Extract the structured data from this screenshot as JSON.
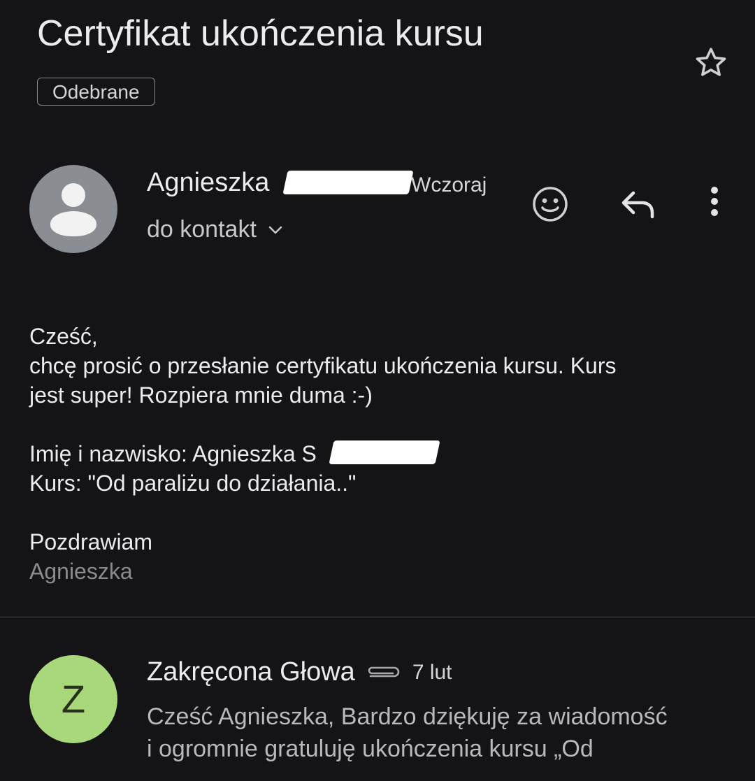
{
  "header": {
    "subject": "Certyfikat ukończenia kursu",
    "label": "Odebrane",
    "star_icon": "star-outline-icon"
  },
  "message": {
    "sender_name": "Agnieszka",
    "date": "Wczoraj",
    "recipient": "do kontakt",
    "avatar_icon": "person-icon",
    "actions": {
      "emoji_icon": "emoji-reaction-icon",
      "reply_icon": "reply-icon",
      "more_icon": "more-vert-icon"
    },
    "body": {
      "greeting": "Cześć,",
      "line1": "chcę prosić o przesłanie certyfikatu ukończenia kursu. Kurs",
      "line2": "jest super! Rozpiera mnie duma :-)",
      "name_line": "Imię i nazwisko: Agnieszka S",
      "course_line": "Kurs: \"Od paraliżu do działania..\"",
      "closing": "Pozdrawiam",
      "signature": "Agnieszka"
    }
  },
  "reply": {
    "avatar_letter": "Z",
    "sender_name": "Zakręcona Głowa",
    "attachment_icon": "paperclip-icon",
    "date": "7 lut",
    "snippet_line1": "Cześć Agnieszka, Bardzo dziękuję za wiadomość",
    "snippet_line2": "i ogromnie gratuluję ukończenia kursu „Od"
  },
  "colors": {
    "background": "#141417",
    "text_primary": "#ececef",
    "text_secondary": "#8a8a8f",
    "avatar_gray": "#8a8d92",
    "avatar_green": "#a8d87a"
  }
}
